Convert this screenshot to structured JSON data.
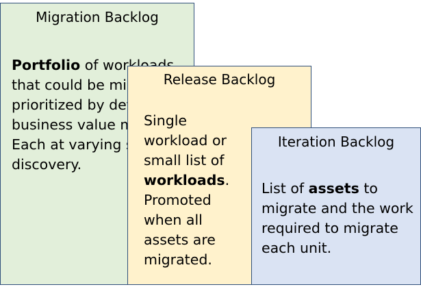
{
  "cards": [
    {
      "title": "Migration Backlog",
      "body": [
        {
          "text": "Portfolio",
          "bold": true
        },
        {
          "text": " of workloads that could be migrated, prioritized by defined business value metrics. Each at varying stages of discovery.",
          "bold": false
        }
      ],
      "color": "#e2efda"
    },
    {
      "title": "Release Backlog",
      "body": [
        {
          "text": "Single workload or small list of ",
          "bold": false
        },
        {
          "text": "workloads",
          "bold": true
        },
        {
          "text": ". Promoted when all assets are migrated.",
          "bold": false
        }
      ],
      "color": "#fff2cc"
    },
    {
      "title": "Iteration Backlog",
      "body": [
        {
          "text": "List of ",
          "bold": false
        },
        {
          "text": "assets",
          "bold": true
        },
        {
          "text": " to migrate and the work required to migrate each unit.",
          "bold": false
        }
      ],
      "color": "#dae3f3"
    }
  ],
  "border_color": "#2f4f7a"
}
